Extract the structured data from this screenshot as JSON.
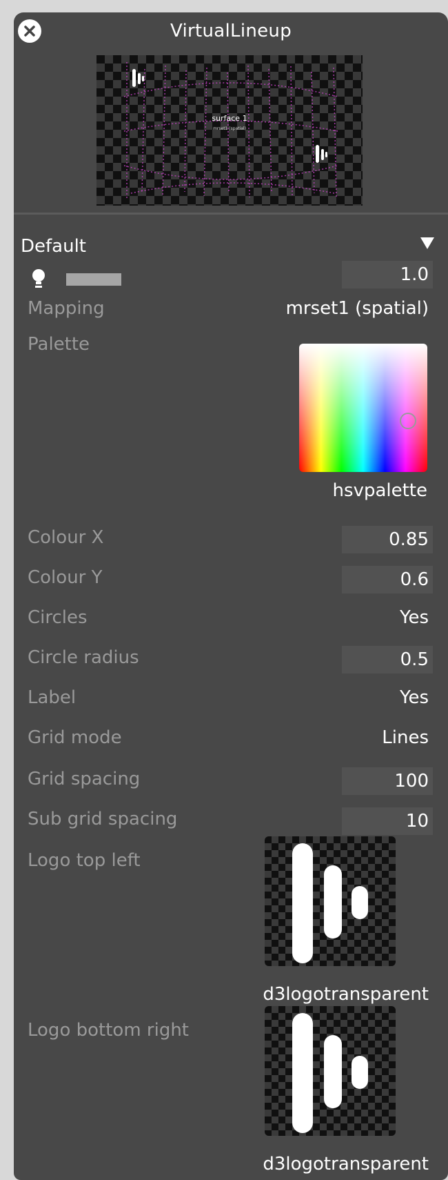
{
  "window": {
    "title": "VirtualLineup"
  },
  "preview": {
    "label_line1": "surface 1",
    "label_line2": "mrset1 (spatial)"
  },
  "preset": {
    "selected": "Default"
  },
  "intensity": {
    "value": "1.0",
    "level": 1.0
  },
  "properties": {
    "mapping": {
      "label": "Mapping",
      "value": "mrset1 (spatial)"
    },
    "palette": {
      "label": "Palette",
      "resource": "hsvpalette"
    },
    "colour_x": {
      "label": "Colour X",
      "value": "0.85"
    },
    "colour_y": {
      "label": "Colour Y",
      "value": "0.6"
    },
    "circles": {
      "label": "Circles",
      "value": "Yes"
    },
    "circle_radius": {
      "label": "Circle radius",
      "value": "0.5"
    },
    "label": {
      "label": "Label",
      "value": "Yes"
    },
    "grid_mode": {
      "label": "Grid mode",
      "value": "Lines"
    },
    "grid_spacing": {
      "label": "Grid spacing",
      "value": "100"
    },
    "sub_grid_spacing": {
      "label": "Sub grid spacing",
      "value": "10"
    },
    "logo_top_left": {
      "label": "Logo top left",
      "resource": "d3logotransparent"
    },
    "logo_bottom_right": {
      "label": "Logo bottom right",
      "resource": "d3logotransparent"
    }
  },
  "colors": {
    "panel_bg": "#484848",
    "label_text": "#9a9a9a",
    "value_text": "#ffffff",
    "field_bg": "#525252",
    "preview_accent": "#c040c0"
  },
  "icons": {
    "close": "close-icon",
    "dropdown": "triangle-down-icon",
    "intensity": "lightbulb-icon"
  }
}
